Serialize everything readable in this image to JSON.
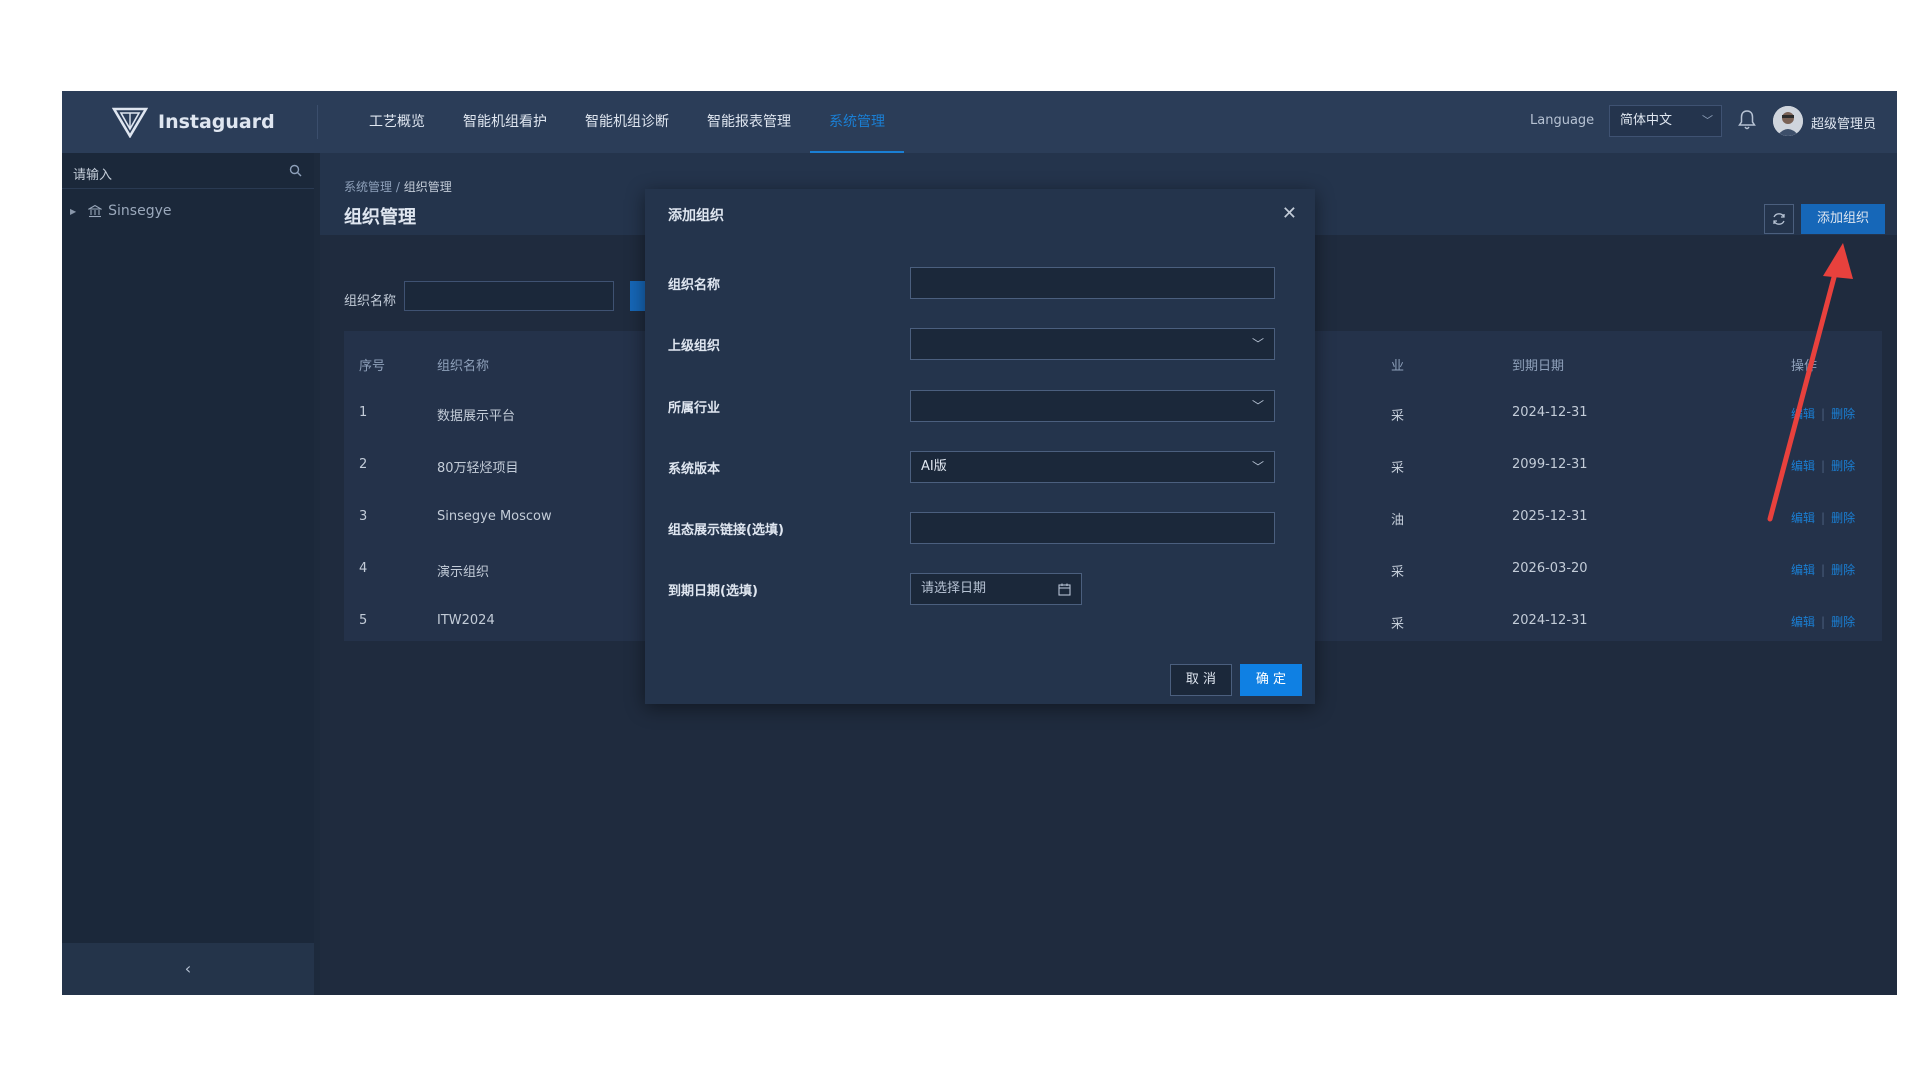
{
  "brand": {
    "name": "Instaguard"
  },
  "nav": [
    {
      "label": "工艺概览",
      "active": false
    },
    {
      "label": "智能机组看护",
      "active": false
    },
    {
      "label": "智能机组诊断",
      "active": false
    },
    {
      "label": "智能报表管理",
      "active": false
    },
    {
      "label": "系统管理",
      "active": true
    }
  ],
  "header": {
    "language_label": "Language",
    "language_value": "简体中文",
    "user_name": "超级管理员"
  },
  "sidebar": {
    "search_placeholder": "请输入",
    "tree": [
      {
        "label": "Sinsegye"
      }
    ]
  },
  "page": {
    "breadcrumb": [
      "系统管理",
      "组织管理"
    ],
    "title": "组织管理",
    "add_button": "添加组织",
    "filter_label": "组织名称"
  },
  "table": {
    "columns": {
      "index": "序号",
      "name": "组织名称",
      "industry": "业",
      "expiry": "到期日期",
      "actions": "操作"
    },
    "rows": [
      {
        "index": "1",
        "name": "数据展示平台",
        "industry": "采",
        "expiry": "2024-12-31"
      },
      {
        "index": "2",
        "name": "80万轻烃项目",
        "industry": "采",
        "expiry": "2099-12-31"
      },
      {
        "index": "3",
        "name": "Sinsegye Moscow",
        "industry": "油",
        "expiry": "2025-12-31"
      },
      {
        "index": "4",
        "name": "演示组织",
        "industry": "采",
        "expiry": "2026-03-20"
      },
      {
        "index": "5",
        "name": "ITW2024",
        "industry": "采",
        "expiry": "2024-12-31"
      }
    ],
    "edit_label": "编辑",
    "delete_label": "删除"
  },
  "modal": {
    "title": "添加组织",
    "fields": {
      "org_name_label": "组织名称",
      "parent_label": "上级组织",
      "industry_label": "所属行业",
      "version_label": "系统版本",
      "version_value": "AI版",
      "link_label": "组态展示链接(选填)",
      "expiry_label": "到期日期(选填)",
      "expiry_placeholder": "请选择日期"
    },
    "cancel": "取 消",
    "ok": "确 定"
  },
  "colors": {
    "accent": "#0f80e3",
    "annotation_arrow": "#e8413d"
  }
}
